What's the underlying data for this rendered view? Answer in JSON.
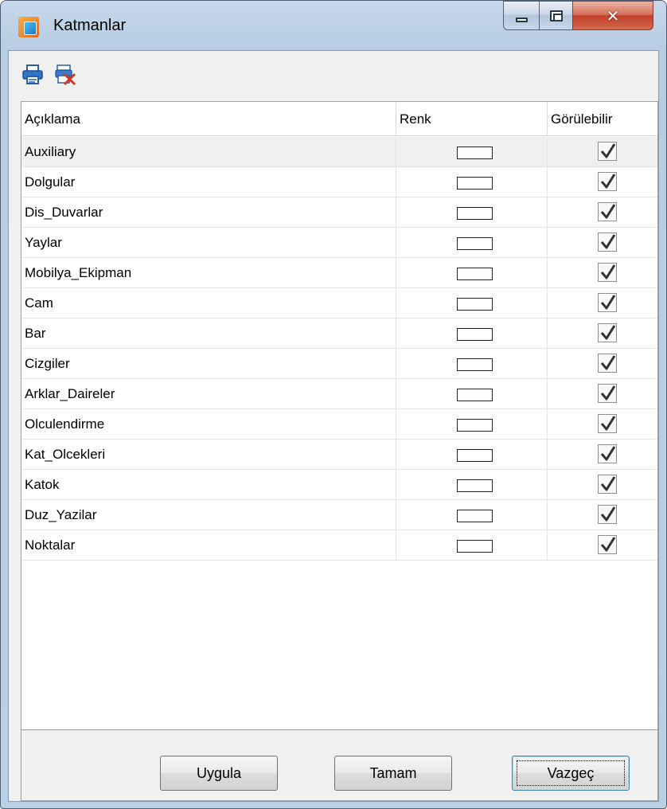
{
  "window": {
    "title": "Katmanlar",
    "icon": "app-icon",
    "controls": [
      "minimize-icon",
      "maximize-icon",
      "close-icon"
    ]
  },
  "toolbar": {
    "items": [
      {
        "icon": "print-icon"
      },
      {
        "icon": "delete-layer-icon"
      }
    ]
  },
  "grid": {
    "columns": [
      "Açıklama",
      "Renk",
      "Görülebilir"
    ],
    "rows": [
      {
        "name": "Auxiliary",
        "color": "#ffffff",
        "visible": true
      },
      {
        "name": "Dolgular",
        "color": "#ffffff",
        "visible": true
      },
      {
        "name": "Dis_Duvarlar",
        "color": "#ffffff",
        "visible": true
      },
      {
        "name": "Yaylar",
        "color": "#ffffff",
        "visible": true
      },
      {
        "name": "Mobilya_Ekipman",
        "color": "#ffffff",
        "visible": true
      },
      {
        "name": "Cam",
        "color": "#ffffff",
        "visible": true
      },
      {
        "name": "Bar",
        "color": "#ffffff",
        "visible": true
      },
      {
        "name": "Cizgiler",
        "color": "#ffffff",
        "visible": true
      },
      {
        "name": "Arklar_Daireler",
        "color": "#ffffff",
        "visible": true
      },
      {
        "name": "Olculendirme",
        "color": "#ffffff",
        "visible": true
      },
      {
        "name": "Kat_Olcekleri",
        "color": "#ffffff",
        "visible": true
      },
      {
        "name": "Katok",
        "color": "#ffffff",
        "visible": true
      },
      {
        "name": "Duz_Yazilar",
        "color": "#ffffff",
        "visible": true
      },
      {
        "name": "Noktalar",
        "color": "#ffffff",
        "visible": true
      }
    ]
  },
  "buttons": {
    "apply": "Uygula",
    "ok": "Tamam",
    "cancel": "Vazgeç"
  }
}
